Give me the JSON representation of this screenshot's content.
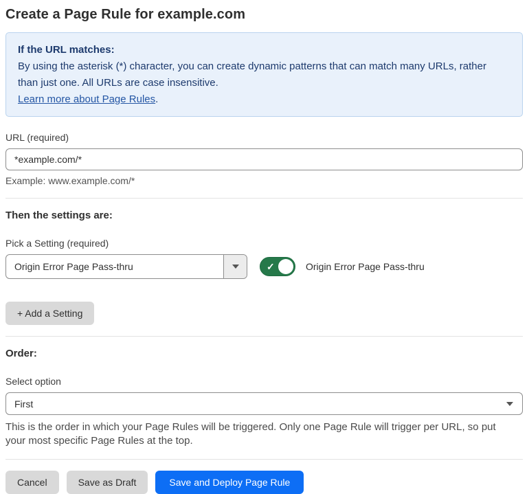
{
  "page": {
    "title": "Create a Page Rule for example.com"
  },
  "info_box": {
    "heading": "If the URL matches:",
    "body": "By using the asterisk (*) character, you can create dynamic patterns that can match many URLs, rather than just one. All URLs are case insensitive.",
    "link_label": "Learn more about Page Rules",
    "link_suffix": "."
  },
  "url_field": {
    "label": "URL (required)",
    "value": "*example.com/*",
    "helper": "Example: www.example.com/*"
  },
  "settings_section": {
    "heading": "Then the settings are:",
    "picker_label": "Pick a Setting (required)",
    "picker_value": "Origin Error Page Pass-thru",
    "toggle_state": "on",
    "toggle_check_glyph": "✓",
    "toggle_label": "Origin Error Page Pass-thru",
    "add_setting_label": "+ Add a Setting"
  },
  "order_section": {
    "heading": "Order:",
    "select_label": "Select option",
    "select_value": "First",
    "helper": "This is the order in which your Page Rules will be triggered. Only one Page Rule will trigger per URL, so put your most specific Page Rules at the top."
  },
  "footer": {
    "cancel_label": "Cancel",
    "save_draft_label": "Save as Draft",
    "save_deploy_label": "Save and Deploy Page Rule"
  },
  "colors": {
    "accent_blue": "#0d6ef5",
    "toggle_green": "#26794a",
    "info_box_bg": "#e9f1fb",
    "info_box_border": "#b9d3ee",
    "info_text": "#1d3a6d",
    "link_blue": "#2456a4",
    "neutral_button_bg": "#d9d9d9"
  },
  "icons": {
    "dropdown_caret": "caret-down-icon",
    "toggle_check": "check-icon"
  }
}
